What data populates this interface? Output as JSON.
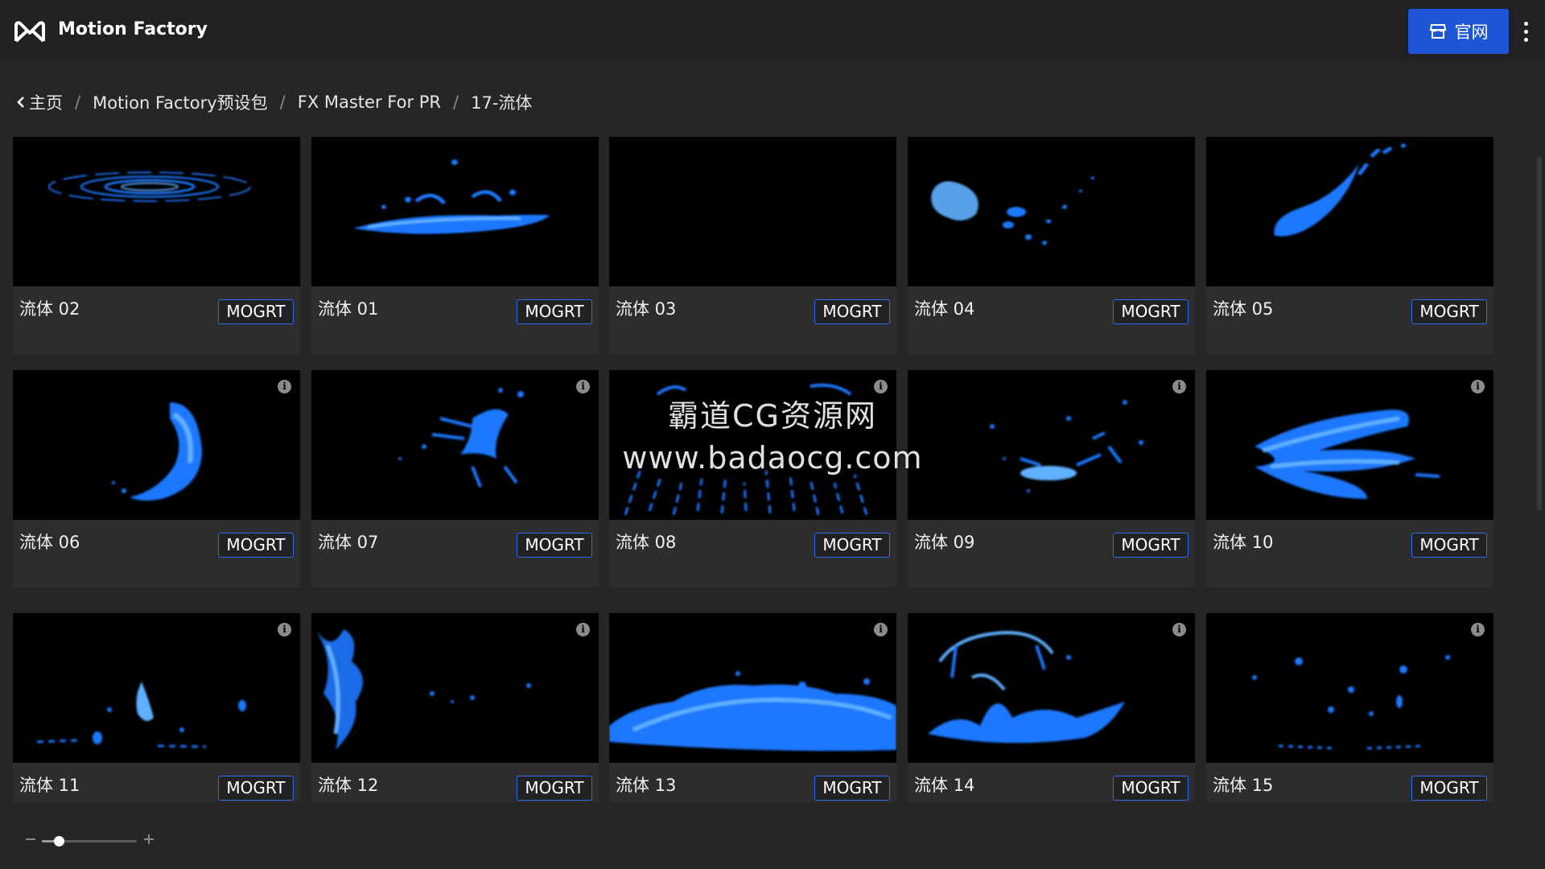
{
  "app": {
    "title": "Motion Factory",
    "site_button_label": "官网"
  },
  "breadcrumb": [
    {
      "label": "主页"
    },
    {
      "label": "Motion Factory预设包"
    },
    {
      "label": "FX Master For PR"
    },
    {
      "label": "17-流体"
    }
  ],
  "tag_label": "MOGRT",
  "info_glyph": "i",
  "cards": [
    {
      "name": "流体 02",
      "art": "ripples"
    },
    {
      "name": "流体 01",
      "art": "splash-low"
    },
    {
      "name": "流体 03",
      "art": "empty"
    },
    {
      "name": "流体 04",
      "art": "blob-drops"
    },
    {
      "name": "流体 05",
      "art": "streak"
    },
    {
      "name": "流体 06",
      "art": "curl"
    },
    {
      "name": "流体 07",
      "art": "burst"
    },
    {
      "name": "流体 08",
      "art": "spray"
    },
    {
      "name": "流体 09",
      "art": "scatter"
    },
    {
      "name": "流体 10",
      "art": "swirl"
    },
    {
      "name": "流体 11",
      "art": "drips"
    },
    {
      "name": "流体 12",
      "art": "side-splash"
    },
    {
      "name": "流体 13",
      "art": "puddle"
    },
    {
      "name": "流体 14",
      "art": "crown"
    },
    {
      "name": "流体 15",
      "art": "dots"
    }
  ],
  "watermark": {
    "line1": "霸道CG资源网",
    "line2": "www.badaocg.com"
  },
  "zoom": {
    "level": 0.18,
    "minus_icon": "minus-icon",
    "plus_icon": "plus-icon"
  },
  "colors": {
    "accent": "#1f56d8",
    "tag_border": "#2f6df0",
    "fluid": "#1e78ff",
    "fluid_light": "#5fb0ff"
  }
}
